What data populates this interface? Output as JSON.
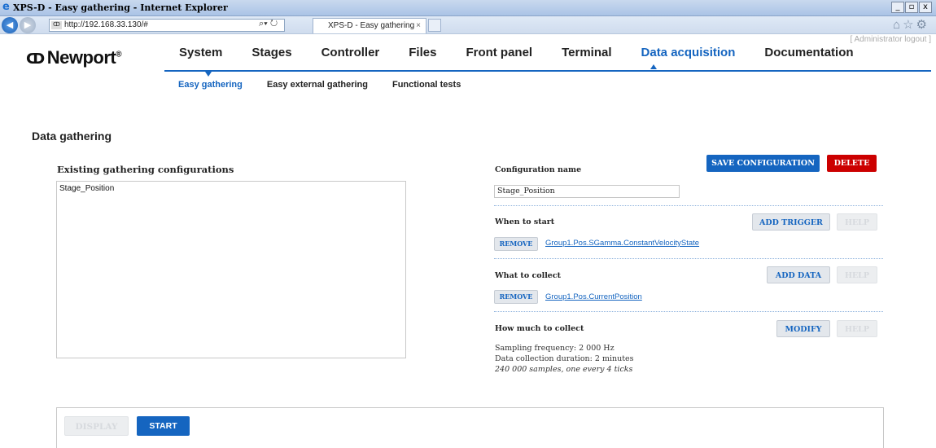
{
  "browser": {
    "window_title": "XPS-D - Easy gathering - Internet Explorer",
    "address": "http://192.168.33.130/#",
    "tab_title": "XPS-D - Easy gathering",
    "tab_close": "×",
    "win_minimize": "_",
    "win_restore": "▫",
    "win_close": "x"
  },
  "header": {
    "admin_logout": "[ Administrator logout ]",
    "logo_text": "Newport",
    "logo_mark": "ↀ",
    "logo_reg": "®"
  },
  "main_nav": [
    {
      "label": "System"
    },
    {
      "label": "Stages"
    },
    {
      "label": "Controller"
    },
    {
      "label": "Files"
    },
    {
      "label": "Front panel"
    },
    {
      "label": "Terminal"
    },
    {
      "label": "Data acquisition"
    },
    {
      "label": "Documentation"
    }
  ],
  "sub_nav": [
    {
      "label": "Easy gathering"
    },
    {
      "label": "Easy external gathering"
    },
    {
      "label": "Functional tests"
    }
  ],
  "page": {
    "title": "Data gathering",
    "existing_title": "Existing gathering configurations",
    "configurations": [
      "Stage_Position"
    ]
  },
  "config": {
    "name_label": "Configuration name",
    "name_value": "Stage_Position",
    "save_label": "SAVE CONFIGURATION",
    "delete_label": "DELETE",
    "start_section": {
      "title": "When to start",
      "add_label": "ADD TRIGGER",
      "help_label": "HELP",
      "remove_label": "REMOVE",
      "item": "Group1.Pos.SGamma.ConstantVelocityState"
    },
    "collect_section": {
      "title": "What to collect",
      "add_label": "ADD DATA",
      "help_label": "HELP",
      "remove_label": "REMOVE",
      "item": "Group1.Pos.CurrentPosition"
    },
    "amount_section": {
      "title": "How much to collect",
      "modify_label": "MODIFY",
      "help_label": "HELP",
      "sampling": "Sampling frequency: 2 000 Hz",
      "duration": "Data collection duration: 2 minutes",
      "samples": "240 000 samples, one every 4 ticks"
    }
  },
  "bottom": {
    "display_label": "DISPLAY",
    "start_label": "START"
  },
  "colors": {
    "accent": "#1565c0",
    "delete": "#cc0000"
  }
}
